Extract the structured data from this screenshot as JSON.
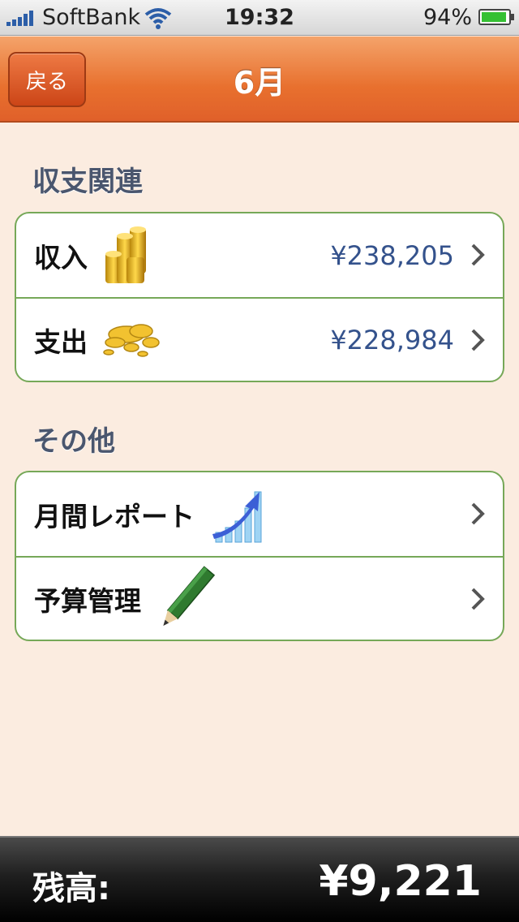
{
  "status": {
    "carrier": "SoftBank",
    "time": "19:32",
    "battery": "94%",
    "battery_level": 0.94
  },
  "nav": {
    "back_label": "戻る",
    "title": "6月"
  },
  "sections": {
    "finance": {
      "header": "収支関連",
      "rows": [
        {
          "label": "収入",
          "value": "¥238,205",
          "icon": "gold-coin-stack-icon"
        },
        {
          "label": "支出",
          "value": "¥228,984",
          "icon": "scattered-coins-icon"
        }
      ]
    },
    "other": {
      "header": "その他",
      "rows": [
        {
          "label": "月間レポート",
          "icon": "growth-chart-icon"
        },
        {
          "label": "予算管理",
          "icon": "pencil-icon"
        }
      ]
    }
  },
  "balance": {
    "label": "残高:",
    "value": "¥9,221"
  },
  "colors": {
    "accent": "#e8702e",
    "value_text": "#34528c",
    "group_border": "#76a858",
    "background": "#fbece0"
  }
}
